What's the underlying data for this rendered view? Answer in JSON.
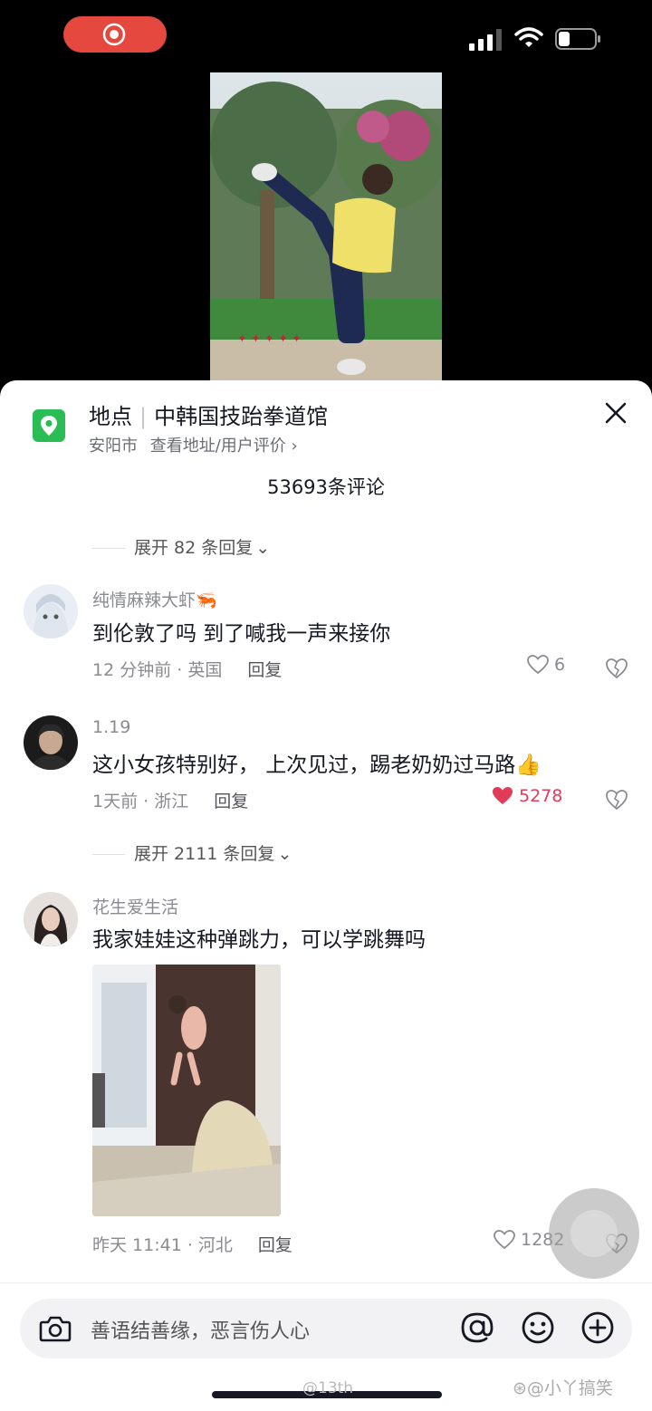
{
  "status_bar": {
    "icons": [
      "screen-record-icon",
      "cellular-signal-icon",
      "wifi-icon",
      "battery-icon"
    ]
  },
  "video": {
    "caption_overlay": ""
  },
  "location": {
    "label": "地点",
    "name": "中韩国技跆拳道馆",
    "city": "安阳市",
    "link": "查看地址/用户评价 ›"
  },
  "comments_header": {
    "count_text": "53693条评论"
  },
  "expand_top": {
    "label": "展开 82 条回复"
  },
  "comments": [
    {
      "username": "纯情麻辣大虾",
      "username_emoji": "🦐",
      "text": "到伦敦了吗 到了喊我一声来接你",
      "time_place": "12 分钟前 · 英国",
      "reply": "回复",
      "likes": "6",
      "liked": false
    },
    {
      "username": "1.19",
      "username_emoji": "",
      "text": "这小女孩特别好， 上次见过，踢老奶奶过马路👍",
      "time_place": "1天前 · 浙江",
      "reply": "回复",
      "likes": "5278",
      "liked": true
    },
    {
      "username": "花生爱生活",
      "username_emoji": "",
      "text": "我家娃娃这种弹跳力，可以学跳舞吗",
      "time_place": "昨天 11:41 · 河北",
      "reply": "回复",
      "likes": "1282",
      "liked": false
    }
  ],
  "expand_mid": {
    "label": "展开 2111 条回复"
  },
  "input": {
    "placeholder": "善语结善缘，恶言伤人心"
  },
  "watermarks": {
    "left": "@13th",
    "right": "@小丫搞笑"
  },
  "colors": {
    "accent_red": "#e13b5a",
    "location_green": "#2bbd55",
    "record_red": "#e5483f"
  }
}
